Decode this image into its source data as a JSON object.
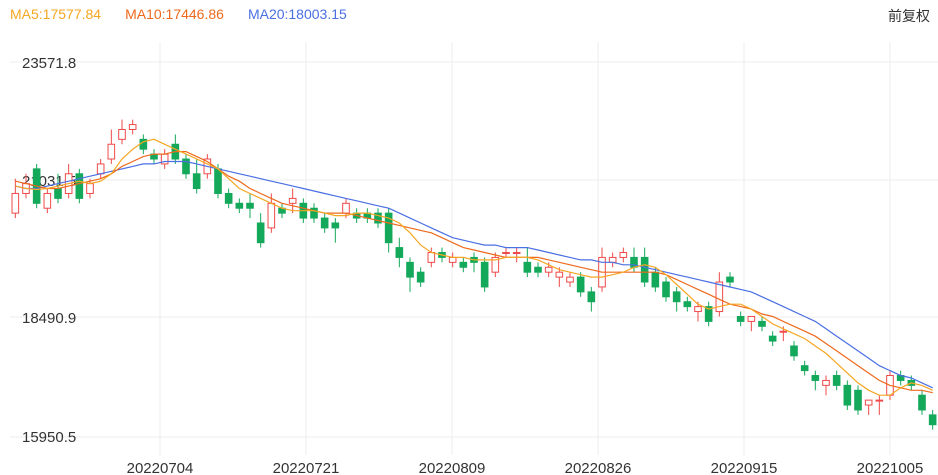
{
  "legend": {
    "ma5": "MA5:17577.84",
    "ma10": "MA10:17446.86",
    "ma20": "MA20:18003.15"
  },
  "adjust_label": "前复权",
  "colors": {
    "up": "#ef4a4a",
    "down": "#14a85b",
    "ma5": "#f5a623",
    "ma10": "#ed6a1c",
    "ma20": "#4a6fe3",
    "grid": "#eeeeee"
  },
  "chart_data": {
    "type": "candlestick",
    "y_ticks": [
      "23571.8",
      "21031.5",
      "18490.9",
      "15950.5"
    ],
    "x_ticks": [
      "20220704",
      "20220721",
      "20220809",
      "20220826",
      "20220915",
      "20221005"
    ],
    "ylim": [
      15950.5,
      23571.8
    ],
    "candles": [
      [
        20500,
        21200,
        20900,
        20400
      ],
      [
        20900,
        21300,
        21100,
        20800
      ],
      [
        21400,
        21500,
        20700,
        20600
      ],
      [
        20600,
        21000,
        20900,
        20500
      ],
      [
        21000,
        21300,
        20800,
        20700
      ],
      [
        20900,
        21500,
        21300,
        20800
      ],
      [
        21300,
        21400,
        20800,
        20700
      ],
      [
        20900,
        21200,
        21100,
        20800
      ],
      [
        21300,
        21600,
        21500,
        21200
      ],
      [
        21600,
        22200,
        21900,
        21500
      ],
      [
        22000,
        22400,
        22200,
        21900
      ],
      [
        22200,
        22400,
        22300,
        22100
      ],
      [
        22000,
        22100,
        21800,
        21700
      ],
      [
        21700,
        21800,
        21600,
        21500
      ],
      [
        21500,
        21800,
        21700,
        21400
      ],
      [
        21900,
        22100,
        21600,
        21500
      ],
      [
        21600,
        21700,
        21300,
        21200
      ],
      [
        21300,
        21600,
        21000,
        20900
      ],
      [
        21300,
        21700,
        21600,
        21200
      ],
      [
        21400,
        21500,
        20900,
        20800
      ],
      [
        20900,
        21000,
        20700,
        20600
      ],
      [
        20700,
        20800,
        20600,
        20500
      ],
      [
        20700,
        20900,
        20600,
        20400
      ],
      [
        20300,
        20500,
        19900,
        19800
      ],
      [
        20200,
        20900,
        20700,
        20100
      ],
      [
        20600,
        20700,
        20500,
        20400
      ],
      [
        20700,
        21000,
        20800,
        20500
      ],
      [
        20700,
        20800,
        20400,
        20300
      ],
      [
        20600,
        20700,
        20400,
        20300
      ],
      [
        20400,
        20500,
        20200,
        20100
      ],
      [
        20300,
        20400,
        20200,
        19900
      ],
      [
        20500,
        20800,
        20700,
        20400
      ],
      [
        20500,
        20600,
        20400,
        20300
      ],
      [
        20500,
        20600,
        20400,
        20300
      ],
      [
        20500,
        20600,
        20300,
        20200
      ],
      [
        20500,
        20600,
        19900,
        19700
      ],
      [
        19800,
        20000,
        19600,
        19400
      ],
      [
        19500,
        19600,
        19200,
        18900
      ],
      [
        19300,
        19400,
        19100,
        19000
      ],
      [
        19500,
        19800,
        19700,
        19400
      ],
      [
        19700,
        19800,
        19600,
        19500
      ],
      [
        19500,
        19700,
        19600,
        19400
      ],
      [
        19500,
        19600,
        19400,
        19300
      ],
      [
        19600,
        19700,
        19500,
        19300
      ],
      [
        19500,
        19600,
        19000,
        18900
      ],
      [
        19300,
        19700,
        19600,
        19200
      ],
      [
        19700,
        19800,
        19700,
        19600
      ],
      [
        19700,
        19800,
        19700,
        19500
      ],
      [
        19500,
        19800,
        19300,
        19200
      ],
      [
        19400,
        19500,
        19300,
        19200
      ],
      [
        19300,
        19500,
        19400,
        19200
      ],
      [
        19200,
        19400,
        19300,
        19000
      ],
      [
        19100,
        19300,
        19200,
        19000
      ],
      [
        19200,
        19300,
        18900,
        18800
      ],
      [
        18900,
        19000,
        18700,
        18500
      ],
      [
        19000,
        19800,
        19600,
        18900
      ],
      [
        19500,
        19700,
        19600,
        19400
      ],
      [
        19600,
        19800,
        19700,
        19500
      ],
      [
        19600,
        19800,
        19400,
        19300
      ],
      [
        19600,
        19800,
        19100,
        19000
      ],
      [
        19300,
        19400,
        19000,
        18900
      ],
      [
        19100,
        19200,
        18800,
        18700
      ],
      [
        18900,
        19000,
        18700,
        18500
      ],
      [
        18700,
        18800,
        18600,
        18500
      ],
      [
        18500,
        18700,
        18600,
        18300
      ],
      [
        18600,
        18700,
        18300,
        18200
      ],
      [
        18500,
        19300,
        19100,
        18400
      ],
      [
        19200,
        19300,
        19100,
        19000
      ],
      [
        18400,
        18500,
        18300,
        18200
      ],
      [
        18300,
        18400,
        18400,
        18100
      ],
      [
        18300,
        18400,
        18200,
        18100
      ],
      [
        18000,
        18100,
        17900,
        17800
      ],
      [
        18100,
        18200,
        18100,
        17900
      ],
      [
        17800,
        17900,
        17600,
        17500
      ],
      [
        17400,
        17500,
        17300,
        17200
      ],
      [
        17200,
        17300,
        17100,
        16900
      ],
      [
        17000,
        17200,
        17100,
        16800
      ],
      [
        17200,
        17300,
        17000,
        16900
      ],
      [
        17000,
        17100,
        16600,
        16500
      ],
      [
        16900,
        17000,
        16500,
        16400
      ],
      [
        16600,
        16700,
        16700,
        16400
      ],
      [
        16700,
        16800,
        16700,
        16400
      ],
      [
        16800,
        17300,
        17200,
        16700
      ],
      [
        17200,
        17300,
        17100,
        17000
      ],
      [
        17100,
        17200,
        17000,
        16900
      ],
      [
        16800,
        16900,
        16500,
        16400
      ],
      [
        16400,
        16500,
        16200,
        16100
      ]
    ],
    "ma5": [
      21050,
      21000,
      20980,
      21000,
      21050,
      21100,
      21150,
      21100,
      21150,
      21300,
      21600,
      21800,
      21950,
      22000,
      21900,
      21800,
      21700,
      21600,
      21500,
      21400,
      21200,
      21000,
      20900,
      20800,
      20700,
      20600,
      20550,
      20550,
      20550,
      20500,
      20450,
      20450,
      20500,
      20500,
      20450,
      20400,
      20300,
      20100,
      19850,
      19700,
      19650,
      19600,
      19600,
      19550,
      19550,
      19550,
      19600,
      19600,
      19600,
      19550,
      19450,
      19350,
      19300,
      19250,
      19200,
      19200,
      19250,
      19300,
      19400,
      19450,
      19400,
      19250,
      19050,
      18850,
      18650,
      18550,
      18600,
      18650,
      18650,
      18550,
      18400,
      18250,
      18150,
      18050,
      17950,
      17800,
      17650,
      17450,
      17250,
      17050,
      16900,
      16800,
      16800,
      16950,
      17050,
      17000,
      16900
    ],
    "ma10": [
      21150,
      21100,
      21050,
      21000,
      21000,
      21050,
      21100,
      21150,
      21200,
      21300,
      21450,
      21550,
      21650,
      21700,
      21700,
      21750,
      21750,
      21650,
      21550,
      21400,
      21250,
      21150,
      21000,
      20900,
      20800,
      20700,
      20650,
      20600,
      20550,
      20500,
      20500,
      20500,
      20450,
      20400,
      20350,
      20300,
      20250,
      20200,
      20150,
      20100,
      20000,
      19900,
      19800,
      19750,
      19700,
      19650,
      19600,
      19600,
      19600,
      19600,
      19550,
      19500,
      19450,
      19400,
      19350,
      19300,
      19300,
      19300,
      19300,
      19300,
      19300,
      19250,
      19150,
      19050,
      18950,
      18850,
      18750,
      18650,
      18600,
      18550,
      18450,
      18400,
      18300,
      18200,
      18100,
      18000,
      17850,
      17700,
      17550,
      17400,
      17250,
      17100,
      17000,
      16950,
      16900,
      16900,
      16850
    ],
    "ma20": [
      21050,
      21000,
      21000,
      21050,
      21100,
      21150,
      21200,
      21250,
      21300,
      21350,
      21400,
      21450,
      21500,
      21500,
      21550,
      21550,
      21550,
      21500,
      21450,
      21400,
      21350,
      21300,
      21250,
      21200,
      21150,
      21100,
      21050,
      21000,
      20950,
      20900,
      20850,
      20800,
      20750,
      20700,
      20650,
      20600,
      20500,
      20400,
      20300,
      20200,
      20100,
      20000,
      19950,
      19900,
      19850,
      19850,
      19800,
      19800,
      19800,
      19750,
      19700,
      19650,
      19600,
      19550,
      19550,
      19500,
      19500,
      19450,
      19450,
      19400,
      19350,
      19300,
      19250,
      19200,
      19150,
      19100,
      19050,
      19000,
      18950,
      18900,
      18800,
      18700,
      18600,
      18500,
      18400,
      18300,
      18150,
      18000,
      17850,
      17700,
      17550,
      17400,
      17300,
      17200,
      17150,
      17050,
      16950
    ]
  }
}
